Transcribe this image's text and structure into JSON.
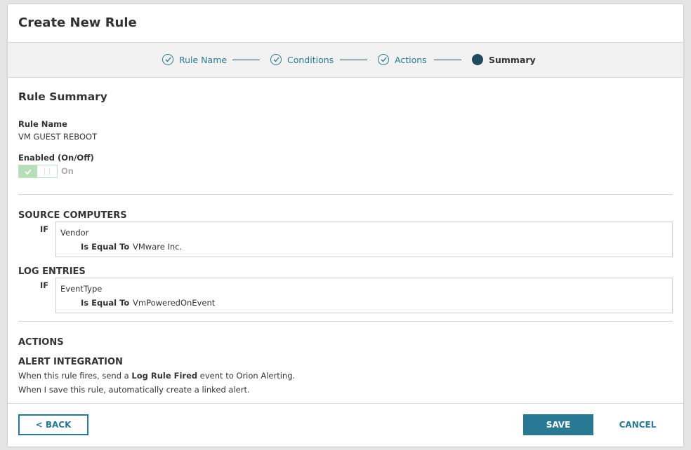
{
  "dialog": {
    "title": "Create New Rule"
  },
  "stepper": {
    "steps": [
      {
        "label": "Rule Name",
        "status": "complete"
      },
      {
        "label": "Conditions",
        "status": "complete"
      },
      {
        "label": "Actions",
        "status": "complete"
      },
      {
        "label": "Summary",
        "status": "current"
      }
    ]
  },
  "summary": {
    "title": "Rule Summary",
    "rule_name_label": "Rule Name",
    "rule_name_value": "VM GUEST REBOOT",
    "enabled_label": "Enabled (On/Off)",
    "enabled_state": "On",
    "source_computers": {
      "title": "SOURCE COMPUTERS",
      "if_label": "IF",
      "field": "Vendor",
      "operator": "Is Equal To",
      "value": "VMware Inc."
    },
    "log_entries": {
      "title": "LOG ENTRIES",
      "if_label": "IF",
      "field": "EventType",
      "operator": "Is Equal To",
      "value": "VmPoweredOnEvent"
    },
    "actions_title": "ACTIONS",
    "alert_integration": {
      "title": "ALERT INTEGRATION",
      "line1_prefix": "When this rule fires, send a ",
      "line1_bold": "Log Rule Fired",
      "line1_suffix": " event to Orion Alerting.",
      "line2": "When I save this rule, automatically create a linked alert."
    }
  },
  "footer": {
    "back_label": "< BACK",
    "save_label": "SAVE",
    "cancel_label": "CANCEL"
  },
  "colors": {
    "accent": "#297994",
    "step_current": "#204a5e",
    "toggle_on": "#b6deb9"
  },
  "icons": {
    "step_complete": "check-circle-icon",
    "step_current": "filled-circle-icon",
    "toggle_on": "check-icon"
  }
}
